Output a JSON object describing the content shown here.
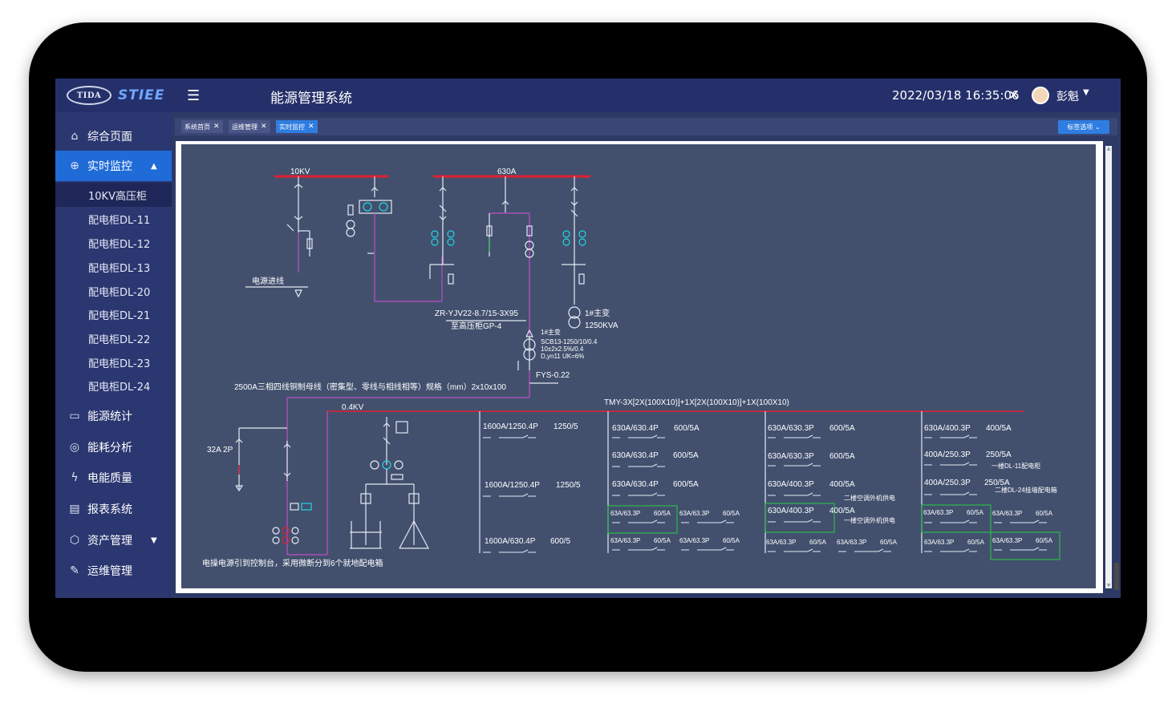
{
  "header": {
    "logo_left": "TIDA",
    "logo_brand": "STIEE",
    "app_title": "能源管理系统",
    "datetime": "2022/03/18 16:35:06",
    "username": "彭魁"
  },
  "sidebar": {
    "items": [
      {
        "label": "综合页面",
        "icon": "home-icon"
      },
      {
        "label": "实时监控",
        "icon": "monitor-icon"
      },
      {
        "label": "能源统计",
        "icon": "stats-icon"
      },
      {
        "label": "能耗分析",
        "icon": "analysis-icon"
      },
      {
        "label": "电能质量",
        "icon": "bolt-icon"
      },
      {
        "label": "报表系统",
        "icon": "report-icon"
      },
      {
        "label": "资产管理",
        "icon": "cube-icon"
      },
      {
        "label": "运维管理",
        "icon": "wrench-icon"
      }
    ],
    "subitems": [
      "10KV高压柜",
      "配电柜DL-11",
      "配电柜DL-12",
      "配电柜DL-13",
      "配电柜DL-20",
      "配电柜DL-21",
      "配电柜DL-22",
      "配电柜DL-23",
      "配电柜DL-24"
    ]
  },
  "tabs": [
    {
      "label": "系统首页"
    },
    {
      "label": "运维管理"
    },
    {
      "label": "实时监控"
    }
  ],
  "tag_options_label": "标签选项",
  "diagram": {
    "bus_10kv": "10KV",
    "bus_630a": "630A",
    "power_in": "电源进线",
    "cable_label": "ZR-YJV22-8.7/15-3X95",
    "cable_target": "至高压柜GP-4",
    "tr1_name": "1#主变",
    "tr1_rating": "1250KVA",
    "tr_small_name": "1#主变",
    "tr_spec1": "SCB13-1250/10/0.4",
    "tr_spec2": "10±2x2.5%/0.4",
    "tr_spec3": "D,yn11 UK=6%",
    "fys": "FYS-0.22",
    "busbar_spec": "2500A三相四线铜制母线（密集型、零线与相线相等）规格（mm）2x10x100",
    "tmy_spec": "TMY-3X[2X(100X10)]+1X[2X(100X10)]+1X(100X10)",
    "bus_04kv": "0.4KV",
    "breaker_32a": "32A 2P",
    "note": "电操电源引到控制台，采用微断分到6个就地配电箱",
    "col1": [
      "1600A/1250.4P",
      "1250/5",
      "1600A/1250.4P",
      "1250/5",
      "1600A/630.4P",
      "600/5"
    ],
    "col2": [
      "630A/630.4P",
      "600/5A",
      "630A/630.4P",
      "600/5A",
      "630A/630.4P",
      "600/5A"
    ],
    "col3": [
      "630A/630.3P",
      "600/5A",
      "630A/630.3P",
      "600/5A",
      "630A/400.3P",
      "400/5A",
      "630A/400.3P",
      "400/5A"
    ],
    "col3_notes": [
      "二楼空调外机供电",
      "一楼空调外机供电"
    ],
    "col4": [
      "630A/400.3P",
      "400/5A",
      "400A/250.3P",
      "250/5A",
      "400A/250.3P",
      "250/5A"
    ],
    "col4_notes": [
      "一楼DL-11配电柜",
      "二楼DL-24挂墙配电箱"
    ],
    "small_breaker": "63A/63.3P",
    "small_ct": "60/5A"
  }
}
